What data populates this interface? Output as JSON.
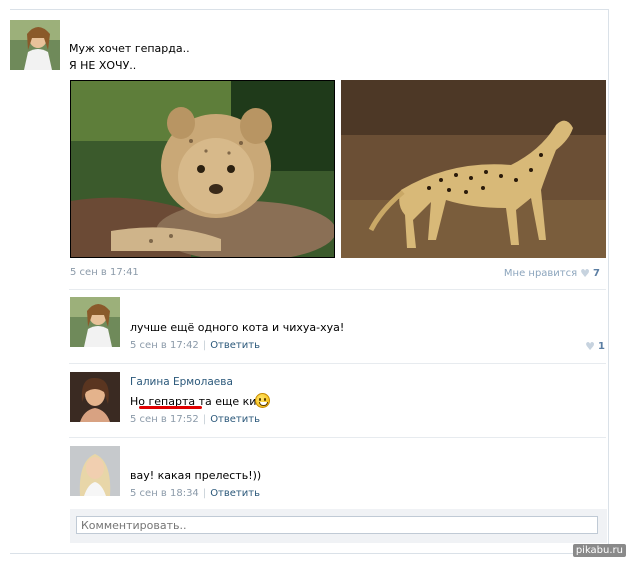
{
  "post": {
    "line1": "Муж хочет гепарда..",
    "line2": "Я НЕ ХОЧУ..",
    "date": "5 сен в 17:41",
    "like_label": "Мне нравится",
    "like_count": "7",
    "photos": [
      "cheetah-cub-photo",
      "adult-cheetah-photo"
    ]
  },
  "comments": [
    {
      "author": "",
      "text": "лучше ещё одного кота и чихуа-хуа!",
      "date": "5 сен в 17:42",
      "reply": "Ответить",
      "like_count": "1"
    },
    {
      "author": "Галина Ермолаева",
      "text": "Но гепарта та еще киса",
      "date": "5 сен в 17:52",
      "reply": "Ответить"
    },
    {
      "author": "",
      "text": "вау! какая прелесть!))",
      "date": "5 сен в 18:34",
      "reply": "Ответить"
    }
  ],
  "comment_box": {
    "placeholder": "Комментировать.."
  },
  "watermark": "pikabu.ru",
  "colors": {
    "link": "#2b587a",
    "meta": "#8b9aa9",
    "underline": "#e00000"
  }
}
